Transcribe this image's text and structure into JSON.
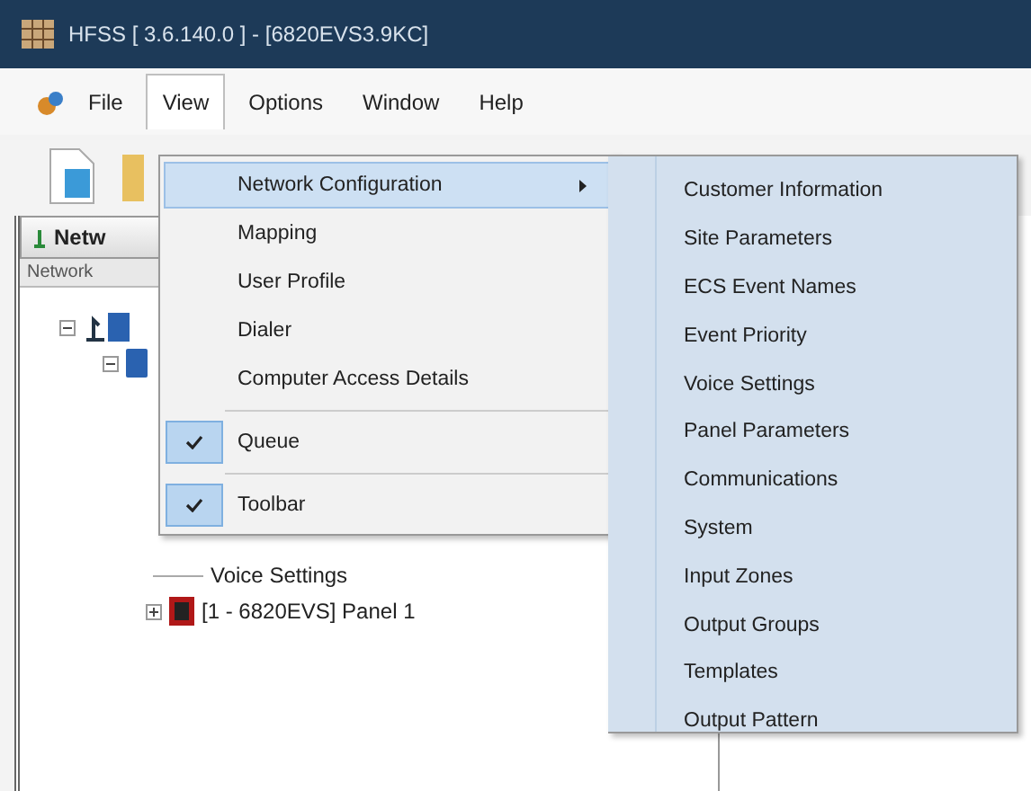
{
  "window": {
    "title": "HFSS [ 3.6.140.0 ] - [6820EVS3.9KC]"
  },
  "menu_bar": [
    {
      "label": "File",
      "selected": false
    },
    {
      "label": "View",
      "selected": true
    },
    {
      "label": "Options",
      "selected": false
    },
    {
      "label": "Window",
      "selected": false
    },
    {
      "label": "Help",
      "selected": false
    }
  ],
  "left_panel": {
    "tab": "Netw",
    "column_header": "Network",
    "tree": [
      {
        "kind": "network",
        "expanded": true,
        "children": [
          {
            "kind": "site",
            "expanded": true,
            "children": [
              {
                "kind": "leaf",
                "label": "Voice Settings"
              },
              {
                "kind": "panel",
                "label": "[1 - 6820EVS] Panel 1",
                "expanded": false
              }
            ]
          }
        ]
      }
    ]
  },
  "view_menu": {
    "groups": [
      [
        {
          "label": "Network Configuration",
          "kind": "submenu",
          "selected": true,
          "checked": false
        },
        {
          "label": "Mapping",
          "kind": "item",
          "selected": false,
          "checked": false
        },
        {
          "label": "User Profile",
          "kind": "item",
          "selected": false,
          "checked": false
        },
        {
          "label": "Dialer",
          "kind": "item",
          "selected": false,
          "checked": false
        },
        {
          "label": "Computer Access Details",
          "kind": "item",
          "selected": false,
          "checked": false
        }
      ],
      [
        {
          "label": "Queue",
          "kind": "item",
          "selected": false,
          "checked": true
        }
      ],
      [
        {
          "label": "Toolbar",
          "kind": "item",
          "selected": false,
          "checked": true
        }
      ]
    ]
  },
  "submenu": [
    "Customer Information",
    "Site Parameters",
    "ECS Event Names",
    "Event Priority",
    "Voice Settings",
    "Panel Parameters",
    "Communications",
    "System",
    "Input Zones",
    "Output Groups",
    "Templates",
    "Output Pattern"
  ]
}
